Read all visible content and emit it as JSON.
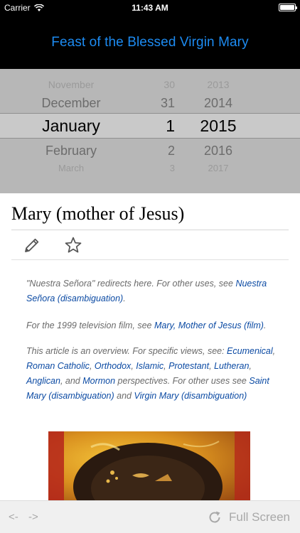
{
  "status_bar": {
    "carrier": "Carrier",
    "time": "11:43 AM"
  },
  "header": {
    "title": "Feast of the Blessed Virgin Mary"
  },
  "picker": {
    "rows": [
      {
        "month": "November",
        "day": "30",
        "year": "2013"
      },
      {
        "month": "December",
        "day": "31",
        "year": "2014"
      },
      {
        "month": "January",
        "day": "1",
        "year": "2015"
      },
      {
        "month": "February",
        "day": "2",
        "year": "2016"
      },
      {
        "month": "March",
        "day": "3",
        "year": "2017"
      }
    ]
  },
  "article": {
    "title": "Mary (mother of Jesus)",
    "hatnote1": {
      "prefix": "\"Nuestra Señora\" redirects here. For other uses, see ",
      "link": "Nuestra Señora (disambiguation)",
      "suffix": "."
    },
    "hatnote2": {
      "prefix": "For the 1999 television film, see ",
      "link": "Mary, Mother of Jesus (film)",
      "suffix": "."
    },
    "hatnote3": {
      "prefix": "This article is an overview. For specific views, see: ",
      "links": [
        "Ecumenical",
        "Roman Catholic",
        "Orthodox",
        "Islamic",
        "Protestant",
        "Lutheran",
        "Anglican",
        "Mormon"
      ],
      "sep1": ", ",
      "sep_and": ", and ",
      "mid": " perspectives. For other uses see ",
      "link_a": "Saint Mary (disambiguation)",
      "and": " and ",
      "link_b": "Virgin Mary (disambiguation)"
    }
  },
  "bottom_bar": {
    "back": "<-",
    "forward": "->",
    "full_screen": "Full Screen"
  },
  "icons": {
    "edit": "pencil-icon",
    "favorite": "star-icon",
    "refresh": "refresh-icon",
    "wifi": "wifi-icon",
    "battery": "battery-icon"
  },
  "colors": {
    "header_title": "#1d8bf1",
    "link": "#0b4aa3",
    "toolbar_text": "#a8a8a8"
  }
}
